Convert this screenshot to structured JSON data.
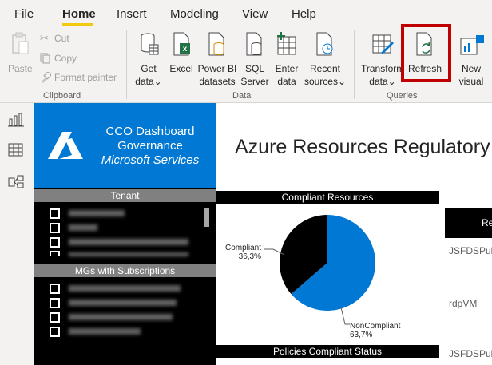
{
  "menu": {
    "items": [
      "File",
      "Home",
      "Insert",
      "Modeling",
      "View",
      "Help"
    ]
  },
  "ribbon": {
    "clipboard": {
      "paste": "Paste",
      "cut": "Cut",
      "copy": "Copy",
      "format_painter": "Format painter",
      "group_label": "Clipboard"
    },
    "data": {
      "get_data_1": "Get",
      "get_data_2": "data",
      "excel": "Excel",
      "powerbi_1": "Power BI",
      "powerbi_2": "datasets",
      "sql_1": "SQL",
      "sql_2": "Server",
      "enter_1": "Enter",
      "enter_2": "data",
      "recent_1": "Recent",
      "recent_2": "sources",
      "group_label": "Data"
    },
    "queries": {
      "transform_1": "Transform",
      "transform_2": "data",
      "refresh": "Refresh",
      "group_label": "Queries"
    },
    "new_visual_1": "New",
    "new_visual_2": "visual"
  },
  "report": {
    "logo_line1": "CCO Dashboard",
    "logo_line2": "Governance",
    "logo_line3": "Microsoft Services",
    "title": "Azure Resources Regulatory C",
    "tenant_header": "Tenant",
    "mgs_header": "MGs with Subscriptions",
    "compliant_resources_header": "Compliant Resources",
    "policies_header": "Policies Compliant Status",
    "table_header_partial": "Re",
    "rows": [
      "JSFDSPullS",
      "rdpVM",
      "JSFDSPullS"
    ]
  },
  "chart_data": {
    "type": "pie",
    "categories": [
      "Compliant",
      "NonCompliant"
    ],
    "values": [
      36.3,
      63.7
    ],
    "labels": [
      "36,3%",
      "63,7%"
    ],
    "colors": [
      "#000000",
      "#0078d4"
    ]
  }
}
